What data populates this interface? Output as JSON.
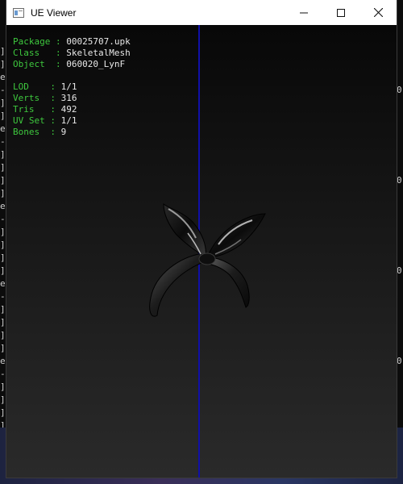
{
  "window": {
    "title": "UE Viewer",
    "controls": {
      "minimize": "minimize-icon",
      "maximize": "maximize-icon",
      "close": "close-icon"
    }
  },
  "info": {
    "package_label": "Package",
    "package_value": "00025707.upk",
    "class_label": "Class",
    "class_value": "SkeletalMesh",
    "object_label": "Object",
    "object_value": "060020_LynF",
    "lod_label": "LOD",
    "lod_value": "1/1",
    "verts_label": "Verts",
    "verts_value": "316",
    "tris_label": "Tris",
    "tris_value": "492",
    "uvset_label": "UV Set",
    "uvset_value": "1/1",
    "bones_label": "Bones",
    "bones_value": "9"
  },
  "colors": {
    "label_green": "#3ec83e",
    "value_white": "#e8e8e8",
    "axis_blue": "#1010a8"
  },
  "background_console": {
    "left_glyphs": [
      "]",
      "]",
      "e",
      "-",
      "]",
      "]",
      "e",
      "-",
      "]",
      "]",
      "]",
      "]",
      "e",
      "-",
      "]",
      "]",
      "]",
      "]",
      "e",
      "-",
      "]",
      "]",
      "]",
      "]",
      "e",
      "-",
      "]",
      "]",
      "]",
      "]",
      "e",
      "-",
      "]"
    ],
    "right_glyphs": [
      "",
      "",
      "",
      "0",
      "",
      "",
      "",
      "",
      "",
      "",
      "0",
      "",
      "",
      "",
      "",
      "",
      "",
      "0",
      "",
      "",
      "",
      "",
      "",
      "",
      "0"
    ]
  }
}
